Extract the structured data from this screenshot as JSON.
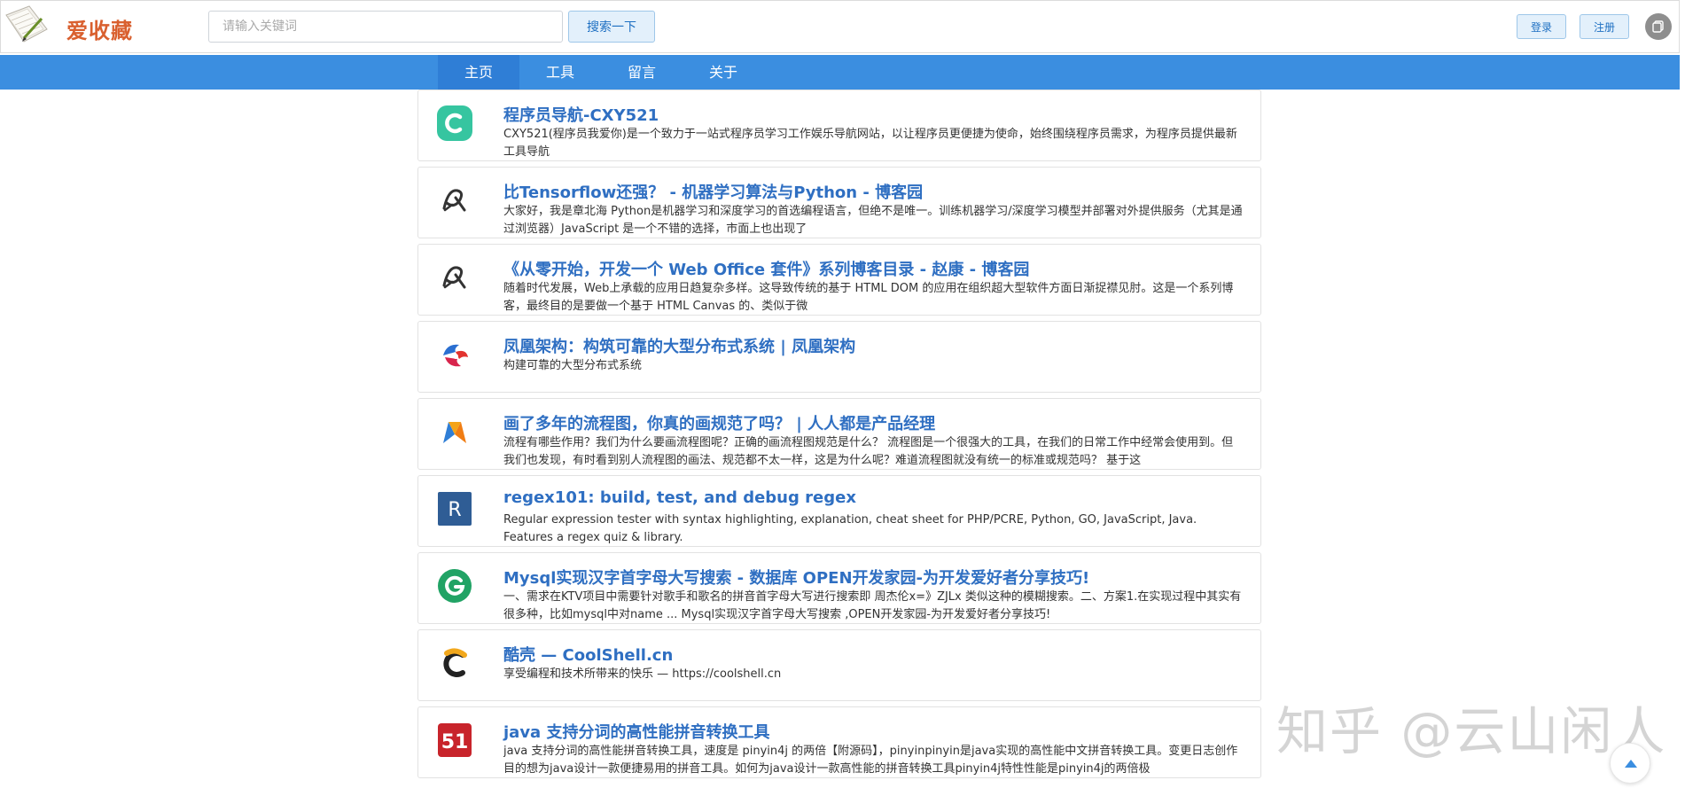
{
  "header": {
    "logo_text": "爱收藏",
    "search_placeholder": "请输入关键词",
    "search_button": "搜索一下",
    "login_button": "登录",
    "register_button": "注册"
  },
  "nav": {
    "items": [
      {
        "label": "主页",
        "active": true
      },
      {
        "label": "工具",
        "active": false
      },
      {
        "label": "留言",
        "active": false
      },
      {
        "label": "关于",
        "active": false
      }
    ]
  },
  "list": [
    {
      "icon": "cxy-c-icon",
      "title": "程序员导航-CXY521",
      "desc": "CXY521(程序员我爱你)是一个致力于一站式程序员学习工作娱乐导航网站，以让程序员更便捷为使命，始终围绕程序员需求，为程序员提供最新工具导航"
    },
    {
      "icon": "cnblogs-icon",
      "title": "比Tensorflow还强？ - 机器学习算法与Python - 博客园",
      "desc": "大家好，我是章北海 Python是机器学习和深度学习的首选编程语言，但绝不是唯一。训练机器学习/深度学习模型并部署对外提供服务（尤其是通过浏览器）JavaScript 是一个不错的选择，市面上也出现了"
    },
    {
      "icon": "cnblogs-icon",
      "title": "《从零开始，开发一个 Web Office 套件》系列博客目录 - 赵康 - 博客园",
      "desc": "随着时代发展，Web上承载的应用日趋复杂多样。这导致传统的基于 HTML DOM 的应用在组织超大型软件方面日渐捉襟见肘。这是一个系列博客，最终目的是要做一个基于 HTML Canvas 的、类似于微"
    },
    {
      "icon": "phoenix-icon",
      "title": "凤凰架构：构筑可靠的大型分布式系统 | 凤凰架构",
      "desc": "构建可靠的大型分布式系统"
    },
    {
      "icon": "woshipm-icon",
      "title": "画了多年的流程图，你真的画规范了吗？ | 人人都是产品经理",
      "desc": "流程有哪些作用？我们为什么要画流程图呢？正确的画流程图规范是什么？ 流程图是一个很强大的工具，在我们的日常工作中经常会使用到。但我们也发现，有时看到别人流程图的画法、规范都不太一样，这是为什么呢？难道流程图就没有统一的标准或规范吗？ 基于这"
    },
    {
      "icon": "regex101-icon",
      "title": "regex101: build, test, and debug regex",
      "desc": "Regular expression tester with syntax highlighting, explanation, cheat sheet for PHP/PCRE, Python, GO, JavaScript, Java. Features a regex quiz & library."
    },
    {
      "icon": "open-g-icon",
      "title": "Mysql实现汉字首字母大写搜索 - 数据库 OPEN开发家园-为开发爱好者分享技巧!",
      "desc": "一、需求在KTV项目中需要针对歌手和歌名的拼音首字母大写进行搜索即 周杰伦x=》ZJLx 类似这种的模糊搜索。二、方案1.在实现过程中其实有很多种，比如mysql中对name ... Mysql实现汉字首字母大写搜索 ,OPEN开发家园-为开发爱好者分享技巧!"
    },
    {
      "icon": "coolshell-icon",
      "title": "酷壳 — CoolShell.cn",
      "desc": "享受编程和技术所带来的快乐 — https://coolshell.cn"
    },
    {
      "icon": "51cto-icon",
      "title": "java 支持分词的高性能拼音转换工具",
      "desc": "java 支持分词的高性能拼音转换工具，速度是 pinyin4j 的两倍【附源码】，pinyinpinyin是java实现的高性能中文拼音转换工具。变更日志创作目的想为java设计一款便捷易用的拼音工具。如何为java设计一款高性能的拼音转换工具pinyin4j特性性能是pinyin4j的两倍极"
    }
  ],
  "watermark": "知乎 @云山闲人"
}
